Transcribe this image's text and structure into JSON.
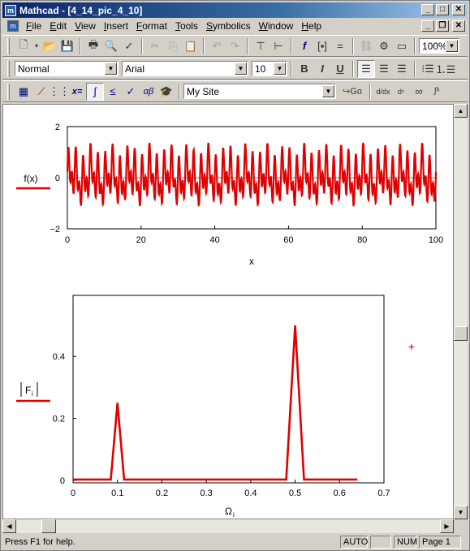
{
  "window": {
    "title": "Mathcad - [4_14_pic_4_10]",
    "app_icon": "m"
  },
  "menubar": {
    "items": [
      "File",
      "Edit",
      "View",
      "Insert",
      "Format",
      "Tools",
      "Symbolics",
      "Window",
      "Help"
    ]
  },
  "toolbar": {
    "zoom": "100%"
  },
  "format_bar": {
    "style": "Normal",
    "font": "Arial",
    "size": "10",
    "bold": "B",
    "italic": "I",
    "underline": "U"
  },
  "math_bar": {
    "site": "My Site",
    "go_label": "Go",
    "xeq_label": "x=",
    "greek_label": "αβ",
    "infinity_label": "∞"
  },
  "status": {
    "help": "Press F1 for help.",
    "auto": "AUTO",
    "num": "NUM",
    "page": "Page 1"
  },
  "plot1": {
    "ylabel": "f(x)",
    "xlabel": "x",
    "xticks": [
      "0",
      "20",
      "40",
      "60",
      "80",
      "100"
    ],
    "yticks": [
      "2",
      "0",
      "−2"
    ]
  },
  "plot2": {
    "ylabel": "F",
    "ylabel_sub": "i",
    "xlabel": "Ω",
    "xlabel_sub": "i",
    "xticks": [
      "0",
      "0.1",
      "0.2",
      "0.3",
      "0.4",
      "0.5",
      "0.6",
      "0.7"
    ],
    "yticks": [
      "0.4",
      "0.2",
      "0"
    ]
  },
  "chart_data": [
    {
      "type": "line",
      "xlabel": "x",
      "ylabel": "f(x)",
      "xlim": [
        0,
        100
      ],
      "ylim": [
        -2,
        2
      ],
      "series": [
        {
          "name": "",
          "color": "#e00000",
          "x_range": [
            0,
            100
          ],
          "y_range": [
            -1.5,
            1.5
          ]
        }
      ]
    },
    {
      "type": "line",
      "xlabel": "Ωi",
      "ylabel": "|Fi|",
      "xlim": [
        0,
        0.7
      ],
      "ylim": [
        0,
        0.5
      ],
      "series": [
        {
          "name": "",
          "color": "#e00000",
          "x": [
            0,
            0.085,
            0.1,
            0.115,
            0.48,
            0.5,
            0.52,
            0.64
          ],
          "y": [
            0.003,
            0.003,
            0.25,
            0.003,
            0.003,
            0.5,
            0.003,
            0.003
          ]
        }
      ]
    }
  ]
}
